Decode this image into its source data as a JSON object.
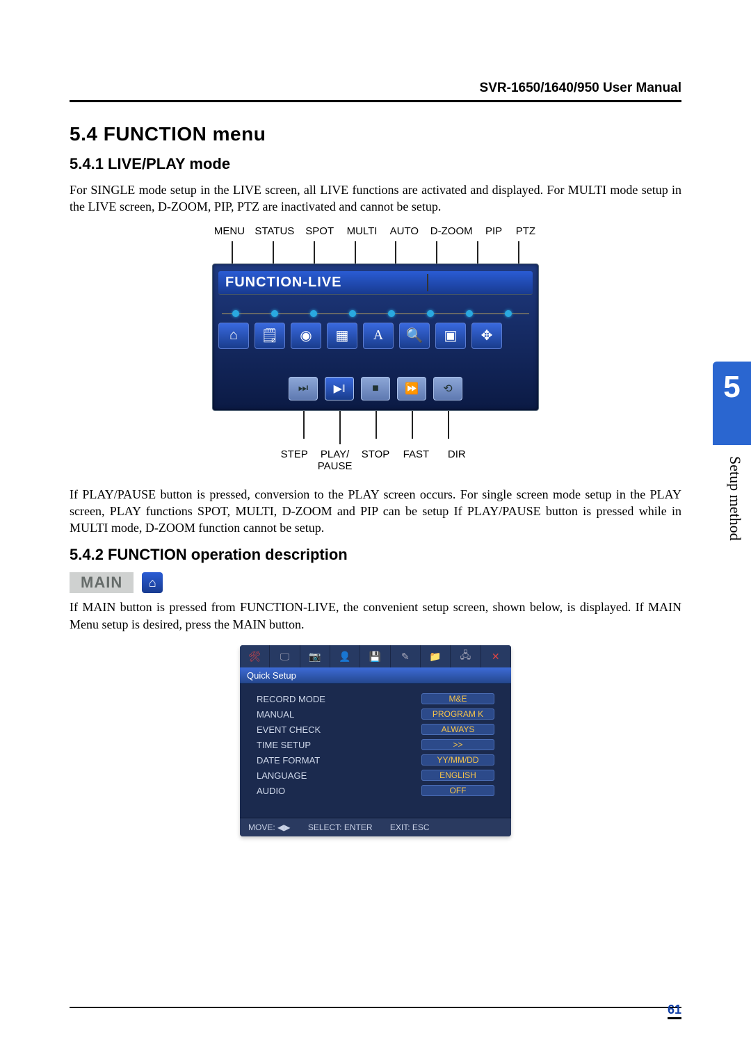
{
  "header": {
    "manual_title": "SVR-1650/1640/950 User Manual"
  },
  "section": {
    "num_title": "5.4 FUNCTION menu",
    "s1_title": "5.4.1 LIVE/PLAY mode",
    "s1_p1": "For SINGLE mode setup in the LIVE screen, all LIVE functions are activated and displayed. For MULTI mode setup in the LIVE screen, D-ZOOM, PIP, PTZ are inactivated and cannot be setup.",
    "s1_p2": "If PLAY/PAUSE button is pressed, conversion to the PLAY screen occurs. For single screen mode setup in the PLAY screen, PLAY functions SPOT, MULTI, D-ZOOM and PIP can be setup If PLAY/PAUSE button is pressed while in MULTI mode, D-ZOOM function cannot be setup.",
    "s2_title": "5.4.2 FUNCTION operation description",
    "s2_main_label": "MAIN",
    "s2_p1": "If MAIN button is pressed from FUNCTION-LIVE, the convenient setup screen, shown below, is displayed. If MAIN Menu setup is desired, press the MAIN button."
  },
  "diagram": {
    "top_labels": [
      "MENU",
      "STATUS",
      "SPOT",
      "MULTI",
      "AUTO",
      "D-ZOOM",
      "PIP",
      "PTZ"
    ],
    "panel_title": "FUNCTION-LIVE",
    "icons_top": [
      "home-icon",
      "clipboard-icon",
      "record-icon",
      "grid-icon",
      "auto-a-icon",
      "zoom-icon",
      "pip-icon",
      "move-icon"
    ],
    "icons_bottom": [
      "step-icon",
      "play-pause-icon",
      "stop-icon",
      "fast-icon",
      "dir-icon"
    ],
    "bot_labels": [
      "STEP",
      "PLAY/ PAUSE",
      "STOP",
      "FAST",
      "DIR"
    ]
  },
  "quick_setup": {
    "title": "Quick Setup",
    "rows": [
      {
        "label": "RECORD MODE",
        "value": "M&E"
      },
      {
        "label": "MANUAL",
        "value": "PROGRAM K"
      },
      {
        "label": "EVENT CHECK",
        "value": "ALWAYS"
      },
      {
        "label": "TIME SETUP",
        "value": ">>"
      },
      {
        "label": "DATE FORMAT",
        "value": "YY/MM/DD"
      },
      {
        "label": "LANGUAGE",
        "value": "ENGLISH"
      },
      {
        "label": "AUDIO",
        "value": "OFF"
      }
    ],
    "footer": {
      "move": "MOVE: ◀▶",
      "select": "SELECT: ENTER",
      "exit": "EXIT: ESC"
    }
  },
  "side": {
    "chapter_num": "5",
    "chapter_label": "Setup method"
  },
  "page_number": "61"
}
